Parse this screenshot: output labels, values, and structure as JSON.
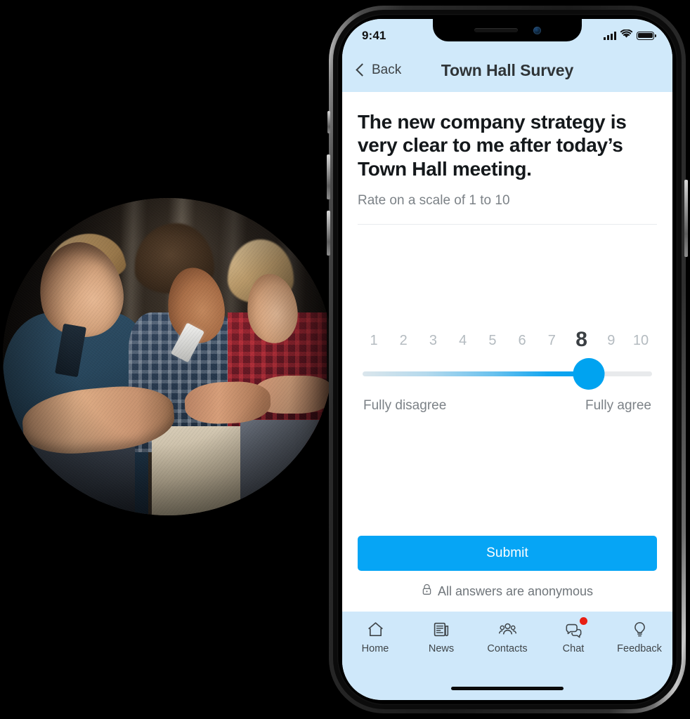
{
  "photo": {
    "alt": "Three workers in a workshop leaning on a railing looking at a smartphone",
    "shape": "ellipse"
  },
  "phone": {
    "status_bar": {
      "time": "9:41",
      "signal_icon": "cellular-signal-icon",
      "wifi_icon": "wifi-icon",
      "battery_icon": "battery-full-icon"
    },
    "nav": {
      "back_label": "Back",
      "back_icon": "chevron-left-icon",
      "title": "Town Hall Survey"
    },
    "survey": {
      "question": "The new company strategy is very clear to me after today’s Town Hall meeting.",
      "subtitle": "Rate on a scale of 1 to 10",
      "scale": [
        "1",
        "2",
        "3",
        "4",
        "5",
        "6",
        "7",
        "8",
        "9",
        "10"
      ],
      "selected_value": 8,
      "min_label": "Fully disagree",
      "max_label": "Fully agree",
      "submit_label": "Submit",
      "anonymous_note": "All answers are anonymous",
      "lock_icon": "lock-icon"
    },
    "tabs": [
      {
        "label": "Home",
        "icon": "home-icon",
        "badge": false
      },
      {
        "label": "News",
        "icon": "newspaper-icon",
        "badge": false
      },
      {
        "label": "Contacts",
        "icon": "people-group-icon",
        "badge": false
      },
      {
        "label": "Chat",
        "icon": "chat-bubbles-icon",
        "badge": true
      },
      {
        "label": "Feedback",
        "icon": "lightbulb-icon",
        "badge": false
      }
    ]
  },
  "colors": {
    "page_background": "#000000",
    "header_blue": "#d0e9fa",
    "tabbar_blue": "#cfe8fa",
    "accent_blue": "#06a5f5",
    "slider_blue": "#00a3f0",
    "badge_red": "#e81f13",
    "text_dark": "#14181b",
    "text_muted": "#7c8287",
    "scale_inactive": "#b4bbc0"
  }
}
